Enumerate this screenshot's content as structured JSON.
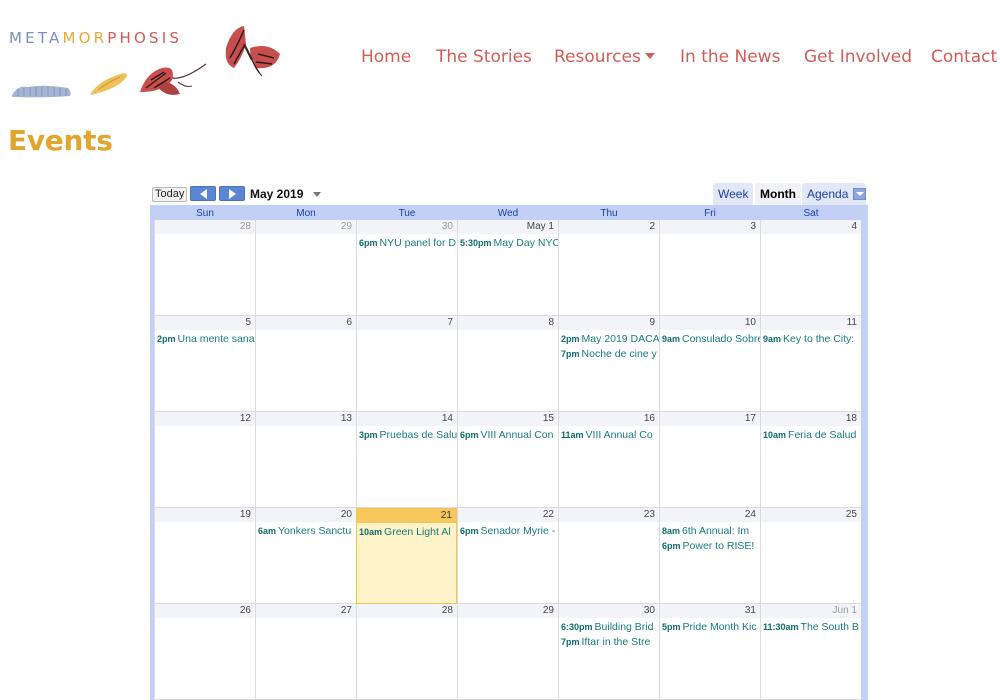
{
  "logo": {
    "word_1": "META",
    "word_2": "MOR",
    "word_3": "PHOSIS",
    "colors": {
      "word_1": "#7b8fc4",
      "word_2": "#e6a83a",
      "word_3": "#d05d57"
    },
    "art": [
      "caterpillar-icon",
      "chrysalis-icon",
      "butterfly-emerging-icon",
      "butterfly-icon"
    ]
  },
  "nav": {
    "items": [
      "Home",
      "The Stories",
      "Resources",
      "In the News",
      "Get Involved",
      "Contact"
    ],
    "color": "#d05d57"
  },
  "page": {
    "title": "Events",
    "title_color": "#e2a52e"
  },
  "calendar": {
    "today_label": "Today",
    "month_label": "May 2019",
    "views": {
      "week": "Week",
      "month": "Month",
      "agenda": "Agenda",
      "active": "Month"
    },
    "days_of_week": [
      "Sun",
      "Mon",
      "Tue",
      "Wed",
      "Thu",
      "Fri",
      "Sat"
    ],
    "weeks": [
      {
        "days": [
          {
            "num": "28",
            "other": true,
            "events": []
          },
          {
            "num": "29",
            "other": true,
            "events": []
          },
          {
            "num": "30",
            "other": true,
            "events": [
              {
                "time": "6pm",
                "title": "NYU panel for D"
              }
            ]
          },
          {
            "num": "May 1",
            "events": [
              {
                "time": "5:30pm",
                "title": "May Day NYC"
              }
            ]
          },
          {
            "num": "2",
            "events": []
          },
          {
            "num": "3",
            "events": []
          },
          {
            "num": "4",
            "events": []
          }
        ]
      },
      {
        "days": [
          {
            "num": "5",
            "events": [
              {
                "time": "2pm",
                "title": "Una mente sana"
              }
            ]
          },
          {
            "num": "6",
            "events": []
          },
          {
            "num": "7",
            "events": []
          },
          {
            "num": "8",
            "events": []
          },
          {
            "num": "9",
            "events": [
              {
                "time": "2pm",
                "title": "May 2019 DACA"
              },
              {
                "time": "7pm",
                "title": "Noche de cine y"
              }
            ]
          },
          {
            "num": "10",
            "events": [
              {
                "time": "9am",
                "title": "Consulado Sobre"
              }
            ]
          },
          {
            "num": "11",
            "events": [
              {
                "time": "9am",
                "title": "Key to the City:"
              }
            ]
          }
        ]
      },
      {
        "days": [
          {
            "num": "12",
            "events": []
          },
          {
            "num": "13",
            "events": []
          },
          {
            "num": "14",
            "events": [
              {
                "time": "3pm",
                "title": "Pruebas de Salud"
              }
            ]
          },
          {
            "num": "15",
            "events": [
              {
                "time": "6pm",
                "title": "VIII Annual Con"
              }
            ]
          },
          {
            "num": "16",
            "events": [
              {
                "time": "11am",
                "title": "VIII Annual Co"
              }
            ]
          },
          {
            "num": "17",
            "events": []
          },
          {
            "num": "18",
            "events": [
              {
                "time": "10am",
                "title": "Feria de Salud"
              }
            ]
          }
        ]
      },
      {
        "days": [
          {
            "num": "19",
            "events": []
          },
          {
            "num": "20",
            "events": [
              {
                "time": "6am",
                "title": "Yonkers Sanctu"
              }
            ]
          },
          {
            "num": "21",
            "today": true,
            "events": [
              {
                "time": "10am",
                "title": "Green Light Al"
              }
            ]
          },
          {
            "num": "22",
            "events": [
              {
                "time": "6pm",
                "title": "Senador Myrie -"
              }
            ]
          },
          {
            "num": "23",
            "events": []
          },
          {
            "num": "24",
            "events": [
              {
                "time": "8am",
                "title": "6th Annual: Im"
              },
              {
                "time": "6pm",
                "title": "Power to RISE!"
              }
            ]
          },
          {
            "num": "25",
            "events": []
          }
        ]
      },
      {
        "days": [
          {
            "num": "26",
            "events": []
          },
          {
            "num": "27",
            "events": []
          },
          {
            "num": "28",
            "events": []
          },
          {
            "num": "29",
            "events": []
          },
          {
            "num": "30",
            "events": [
              {
                "time": "6:30pm",
                "title": "Building Brid"
              },
              {
                "time": "7pm",
                "title": "Iftar in the Stre"
              }
            ]
          },
          {
            "num": "31",
            "events": [
              {
                "time": "5pm",
                "title": "Pride Month Kic"
              }
            ]
          },
          {
            "num": "Jun 1",
            "other": true,
            "events": [
              {
                "time": "11:30am",
                "title": "The South B"
              }
            ]
          }
        ]
      }
    ]
  }
}
